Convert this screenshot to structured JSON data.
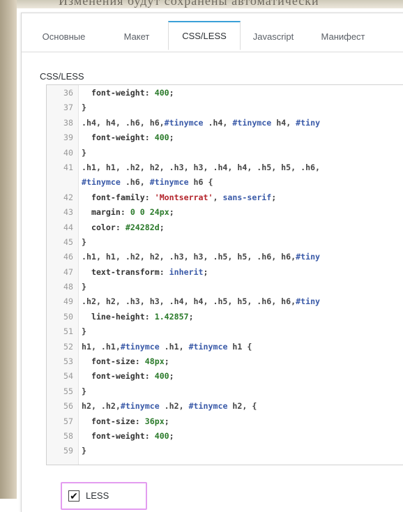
{
  "background_title": "Изменения будут сохранены автоматически",
  "tabs": [
    {
      "label": "Основные",
      "active": false
    },
    {
      "label": "Макет",
      "active": false
    },
    {
      "label": "CSS/LESS",
      "active": true
    },
    {
      "label": "Javascript",
      "active": false
    },
    {
      "label": "Манифест",
      "active": false
    }
  ],
  "section_label": "CSS/LESS",
  "editor": {
    "lines": [
      {
        "n": "36",
        "text": "  font-weight: 400;"
      },
      {
        "n": "37",
        "text": "}"
      },
      {
        "n": "38",
        "text": ".h4, h4, .h6, h6,#tinymce .h4, #tinymce h4, #tiny"
      },
      {
        "n": "39",
        "text": "  font-weight: 400;"
      },
      {
        "n": "40",
        "text": "}"
      },
      {
        "n": "41",
        "text": ".h1, h1, .h2, h2, .h3, h3, .h4, h4, .h5, h5, .h6,"
      },
      {
        "n": "",
        "text": "#tinymce .h6, #tinymce h6 {"
      },
      {
        "n": "42",
        "text": "  font-family: 'Montserrat', sans-serif;"
      },
      {
        "n": "43",
        "text": "  margin: 0 0 24px;"
      },
      {
        "n": "44",
        "text": "  color: #24282d;"
      },
      {
        "n": "45",
        "text": "}"
      },
      {
        "n": "46",
        "text": ".h1, h1, .h2, h2, .h3, h3, .h5, h5, .h6, h6,#tiny"
      },
      {
        "n": "47",
        "text": "  text-transform: inherit;"
      },
      {
        "n": "48",
        "text": "}"
      },
      {
        "n": "49",
        "text": ".h2, h2, .h3, h3, .h4, h4, .h5, h5, .h6, h6,#tiny"
      },
      {
        "n": "50",
        "text": "  line-height: 1.42857;"
      },
      {
        "n": "51",
        "text": "}"
      },
      {
        "n": "52",
        "text": "h1, .h1,#tinymce .h1, #tinymce h1 {"
      },
      {
        "n": "53",
        "text": "  font-size: 48px;"
      },
      {
        "n": "54",
        "text": "  font-weight: 400;"
      },
      {
        "n": "55",
        "text": "}"
      },
      {
        "n": "56",
        "text": "h2, .h2,#tinymce .h2, #tinymce h2, {"
      },
      {
        "n": "57",
        "text": "  font-size: 36px;"
      },
      {
        "n": "58",
        "text": "  font-weight: 400;"
      },
      {
        "n": "59",
        "text": "}"
      }
    ]
  },
  "less_checkbox": {
    "label": "LESS",
    "checked": true
  },
  "colors": {
    "active_tab_accent": "#3aa0d8",
    "highlight_outline": "#e39cf0",
    "keyword": "#3a5aa8",
    "number": "#2a7a2a",
    "string": "#b3242b"
  }
}
